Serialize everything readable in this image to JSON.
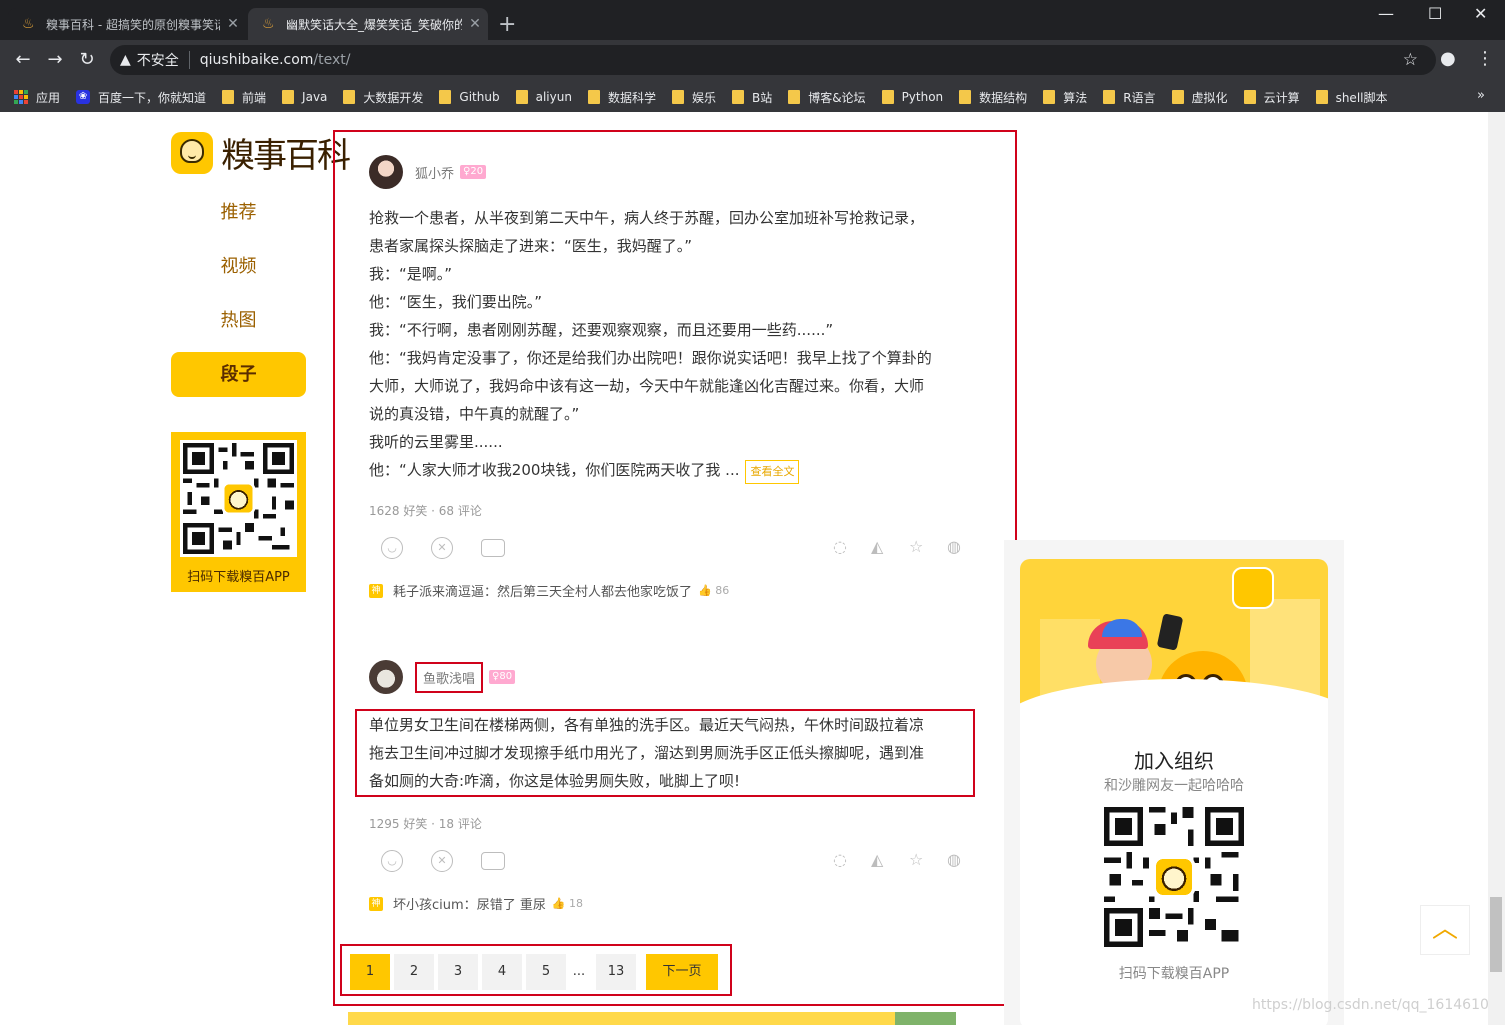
{
  "browser": {
    "tabs": [
      {
        "title": "糗事百科 - 超搞笑的原创糗事笑话",
        "active": false
      },
      {
        "title": "幽默笑话大全_爆笑笑话_笑破你的",
        "active": true
      }
    ],
    "new_tab": "+",
    "window_controls": {
      "minimize": "—",
      "maximize": "☐",
      "close": "✕"
    },
    "nav": {
      "back": "←",
      "forward": "→",
      "reload": "↻"
    },
    "address": {
      "security_label": "不安全",
      "host": "qiushibaike.com",
      "path": "/text/"
    },
    "bookmarks": [
      "应用",
      "百度一下，你就知道",
      "前端",
      "Java",
      "大数据开发",
      "Github",
      "aliyun",
      "数据科学",
      "娱乐",
      "B站",
      "博客&论坛",
      "Python",
      "数据结构",
      "算法",
      "R语言",
      "虚拟化",
      "云计算",
      "shell脚本"
    ],
    "bookmarks_more": "»"
  },
  "site": {
    "logo_text": "糗事百科",
    "nav": [
      {
        "label": "推荐",
        "active": false
      },
      {
        "label": "视频",
        "active": false
      },
      {
        "label": "热图",
        "active": false
      },
      {
        "label": "段子",
        "active": true
      }
    ],
    "qr_label": "扫码下载糗百APP"
  },
  "posts": [
    {
      "author": "狐小乔",
      "level": "20",
      "lines": [
        "抢救一个患者，从半夜到第二天中午，病人终于苏醒，回办公室加班补写抢救记录，",
        "患者家属探头探脑走了进来：“医生，我妈醒了。”",
        "我：“是啊。”",
        "他：“医生，我们要出院。”",
        "我：“不行啊，患者刚刚苏醒，还要观察观察，而且还要用一些药......”",
        "他：“我妈肯定没事了，你还是给我们办出院吧！跟你说实话吧！我早上找了个算卦的",
        "大师，大师说了，我妈命中该有这一劫，今天中午就能逢凶化吉醒过来。你看，大师",
        "说的真没错，中午真的就醒了。”",
        "我听的云里雾里......",
        "他：“人家大师才收我200块钱，你们医院两天收了我 ..."
      ],
      "read_more": "查看全文",
      "stats": "1628 好笑 · 68 评论",
      "hot_comment": {
        "user": "耗子派来滴逗逼",
        "text": "然后第三天全村人都去他家吃饭了",
        "likes": "86"
      }
    },
    {
      "author": "鱼歌浅唱",
      "level": "80",
      "lines": [
        "单位男女卫生间在楼梯两侧，各有单独的洗手区。最近天气闷热，午休时间趿拉着凉",
        "拖去卫生间冲过脚才发现擦手纸巾用光了，溜达到男厕洗手区正低头擦脚呢，遇到准",
        "备如厕的大奇:咋滴，你这是体验男厕失败，呲脚上了呗!"
      ],
      "stats": "1295 好笑 · 18 评论",
      "hot_comment": {
        "user": "坏小孩cium",
        "text": "尿错了 重尿",
        "likes": "18"
      }
    }
  ],
  "pagination": {
    "pages": [
      "1",
      "2",
      "3",
      "4",
      "5"
    ],
    "ellipsis": "...",
    "last": "13",
    "next": "下一页",
    "current": "1"
  },
  "sidebar_card": {
    "title": "加入组织",
    "subtitle": "和沙雕网友一起哈哈哈",
    "qr_label": "扫码下载糗百APP"
  },
  "watermark": "https://blog.csdn.net/qq_16146103",
  "colors": {
    "brand_yellow": "#ffc700",
    "highlight_red": "#d0021b",
    "level_pink": "#ffa9d0"
  }
}
